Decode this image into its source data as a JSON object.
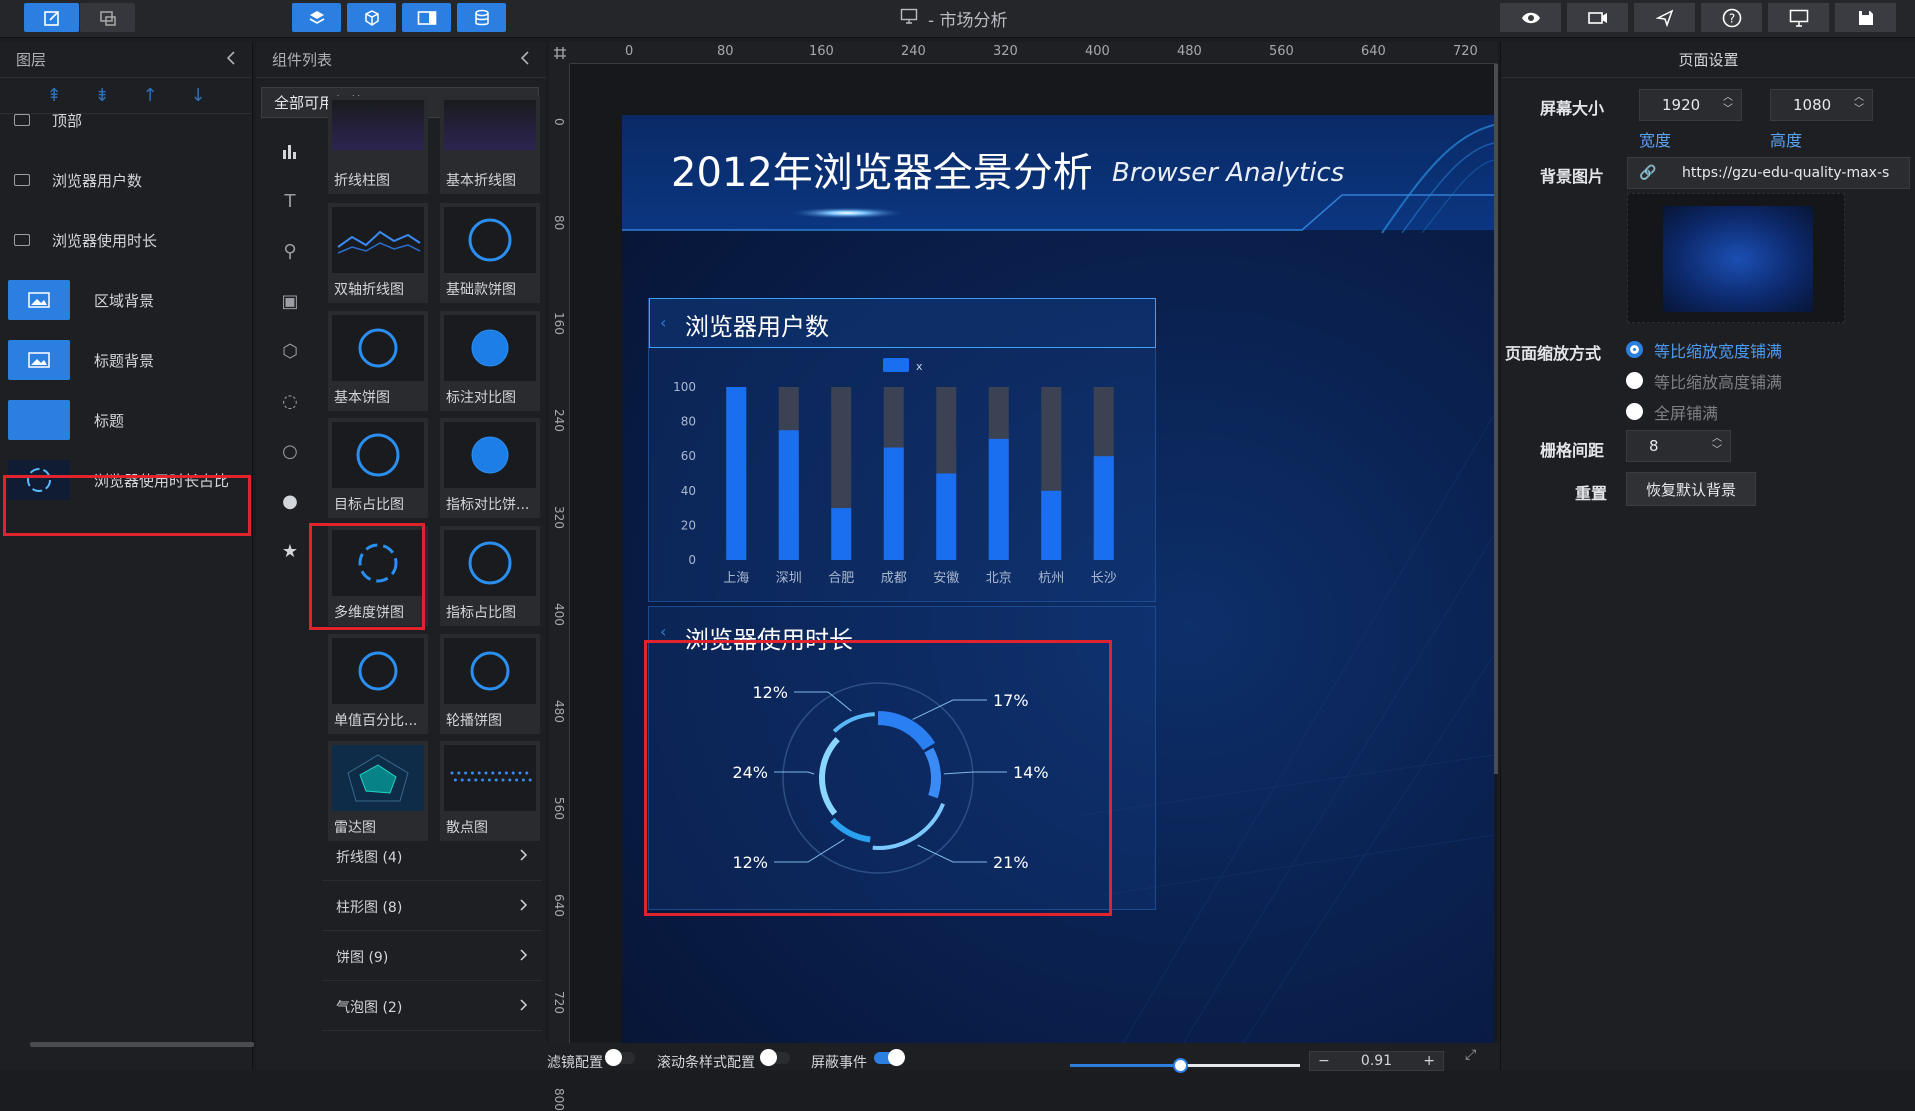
{
  "toolbar": {
    "title": "- 市场分析",
    "left_icons": [
      "edit-icon",
      "screen-icon"
    ],
    "center_icons": [
      "layers-icon",
      "cube-icon",
      "panel-icon",
      "database-icon"
    ],
    "right_icons": [
      "eye-icon",
      "video-icon",
      "send-icon",
      "help-icon",
      "monitor-icon",
      "save-icon"
    ]
  },
  "layers": {
    "header": "图层",
    "items": [
      {
        "label": "顶部",
        "type": "folder"
      },
      {
        "label": "浏览器用户数",
        "type": "folder"
      },
      {
        "label": "浏览器使用时长",
        "type": "folder"
      },
      {
        "label": "区域背景",
        "type": "image"
      },
      {
        "label": "标题背景",
        "type": "image"
      },
      {
        "label": "标题",
        "type": "title"
      },
      {
        "label": "浏览器使用时长占比",
        "type": "pie",
        "selected": true
      }
    ]
  },
  "components": {
    "header": "组件列表",
    "filter": "全部可用组件",
    "cards": [
      {
        "label": "折线柱图"
      },
      {
        "label": "基本折线图"
      },
      {
        "label": "双轴折线图"
      },
      {
        "label": "基础款饼图"
      },
      {
        "label": "基本饼图"
      },
      {
        "label": "标注对比图"
      },
      {
        "label": "目标占比图"
      },
      {
        "label": "指标对比饼..."
      },
      {
        "label": "多维度饼图"
      },
      {
        "label": "指标占比图"
      },
      {
        "label": "单值百分比..."
      },
      {
        "label": "轮播饼图"
      },
      {
        "label": "雷达图"
      },
      {
        "label": "散点图"
      }
    ],
    "categories": [
      {
        "label": "折线图 (4)"
      },
      {
        "label": "柱形图 (8)"
      },
      {
        "label": "饼图 (9)"
      },
      {
        "label": "气泡图 (2)"
      }
    ]
  },
  "ruler": {
    "top": [
      "0",
      "80",
      "160",
      "240",
      "320",
      "400",
      "480",
      "560",
      "640",
      "720"
    ],
    "left": [
      "0",
      "80",
      "160",
      "240",
      "320",
      "400",
      "480",
      "560",
      "640",
      "720",
      "800"
    ]
  },
  "stage": {
    "title": "2012年浏览器全景分析",
    "subtitle": "Browser Analytics",
    "panel1_title": "浏览器用户数",
    "panel2_title": "浏览器使用时长",
    "legend_x": "x"
  },
  "chart_data": [
    {
      "type": "bar",
      "categories": [
        "上海",
        "深圳",
        "合肥",
        "成都",
        "安徽",
        "北京",
        "杭州",
        "长沙"
      ],
      "series": [
        {
          "name": "x",
          "values": [
            100,
            75,
            30,
            65,
            50,
            70,
            40,
            60
          ]
        }
      ],
      "background_max": 100,
      "ylim": [
        0,
        100
      ],
      "yticks": [
        0,
        20,
        40,
        60,
        80,
        100
      ],
      "colors": {
        "bar": "#1a6ff0",
        "track": "#3a4254"
      }
    },
    {
      "type": "pie",
      "labels": [
        "17%",
        "14%",
        "21%",
        "12%",
        "24%",
        "12%"
      ],
      "values": [
        17,
        14,
        21,
        12,
        24,
        12
      ],
      "colors": [
        "#2a7ff2",
        "#3a8bf5",
        "#7cc9ff",
        "#2aa0f0",
        "#8ad6ff",
        "#5ab8f8"
      ]
    }
  ],
  "page_settings": {
    "header": "页面设置",
    "screen_size_label": "屏幕大小",
    "width_value": "1920",
    "height_value": "1080",
    "width_label": "宽度",
    "height_label": "高度",
    "bg_image_label": "背景图片",
    "bg_image_url": "https://gzu-edu-quality-max-s",
    "scale_label": "页面缩放方式",
    "scale_options": [
      "等比缩放宽度铺满",
      "等比缩放高度铺满",
      "全屏铺满"
    ],
    "grid_label": "栅格间距",
    "grid_value": "8",
    "reset_label": "重置",
    "reset_button": "恢复默认背景"
  },
  "bottom_bar": {
    "filter_config": "滤镜配置",
    "scroll_config": "滚动条样式配置",
    "mask_event": "屏蔽事件",
    "zoom": "0.91",
    "minus": "−",
    "plus": "+"
  }
}
